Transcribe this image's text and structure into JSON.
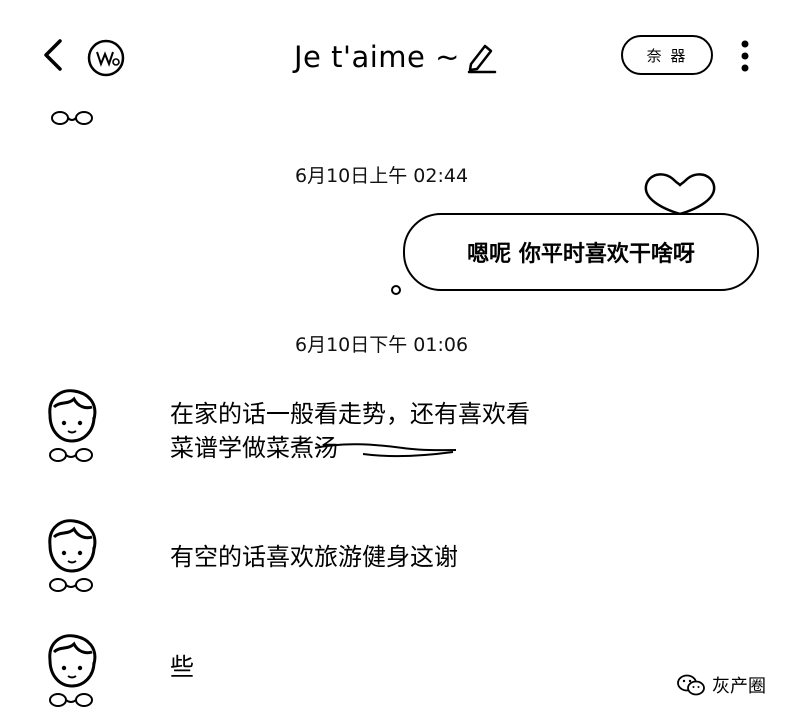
{
  "header": {
    "title": "Je  t'aime ~",
    "pill_button_label": "奈 器"
  },
  "timestamps": [
    "6月10日上午 02:44",
    "6月10日下午 01:06"
  ],
  "sent_message": {
    "text": "嗯呢 你平时喜欢干啥呀"
  },
  "received_messages": [
    {
      "lines": [
        "在家的话一般看走势，还有喜欢看",
        "菜谱学做菜煮汤"
      ]
    },
    {
      "lines": [
        "有空的话喜欢旅游健身这谢"
      ]
    },
    {
      "lines": [
        "些"
      ]
    }
  ],
  "watermark": {
    "text": "灰产圈"
  },
  "icons": {
    "back": "back-arrow-icon",
    "profile": "profile-badge-icon",
    "edit": "edit-pencil-icon",
    "more": "more-vertical-icon",
    "avatar": "cartoon-avatar-icon",
    "watermark": "wechat-icon"
  }
}
